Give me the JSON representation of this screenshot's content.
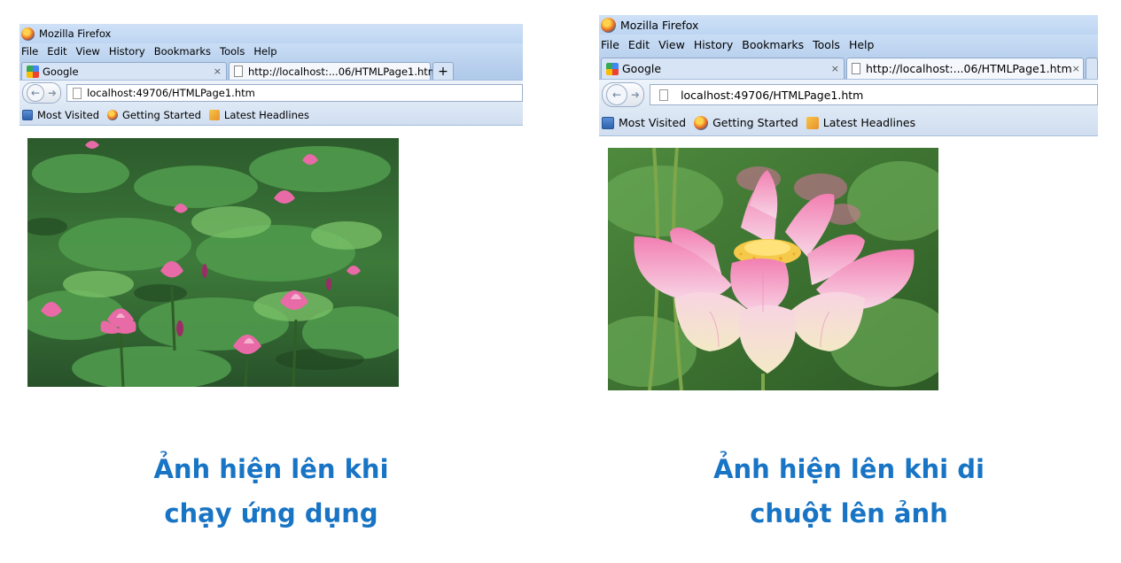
{
  "left_browser": {
    "window_title": "Mozilla Firefox",
    "menu": [
      "File",
      "Edit",
      "View",
      "History",
      "Bookmarks",
      "Tools",
      "Help"
    ],
    "tabs": [
      {
        "label": "Google",
        "close": "×"
      },
      {
        "label": "http://localhost:...06/HTMLPage1.htm",
        "close": "×"
      }
    ],
    "new_tab": "+",
    "url": "localhost:49706/HTMLPage1.htm",
    "bookmarks": [
      "Most Visited",
      "Getting Started",
      "Latest Headlines"
    ]
  },
  "right_browser": {
    "window_title": "Mozilla Firefox",
    "menu": [
      "File",
      "Edit",
      "View",
      "History",
      "Bookmarks",
      "Tools",
      "Help"
    ],
    "tabs": [
      {
        "label": "Google",
        "close": "×"
      },
      {
        "label": "http://localhost:...06/HTMLPage1.htm",
        "close": "×"
      }
    ],
    "url": "localhost:49706/HTMLPage1.htm",
    "bookmarks": [
      "Most Visited",
      "Getting Started",
      "Latest Headlines"
    ]
  },
  "captions": {
    "left_line1": "Ảnh hiện lên khi",
    "left_line2": "chạy ứng dụng",
    "right_line1": "Ảnh hiện lên khi di",
    "right_line2": "chuột lên ảnh"
  },
  "colors": {
    "caption": "#1874c4",
    "chrome_blue": "#bdd5f2"
  },
  "icons": [
    "firefox-icon",
    "google-favicon",
    "page-icon",
    "back-arrow-icon",
    "forward-arrow-icon",
    "most-visited-icon",
    "getting-started-icon",
    "rss-feed-icon"
  ]
}
